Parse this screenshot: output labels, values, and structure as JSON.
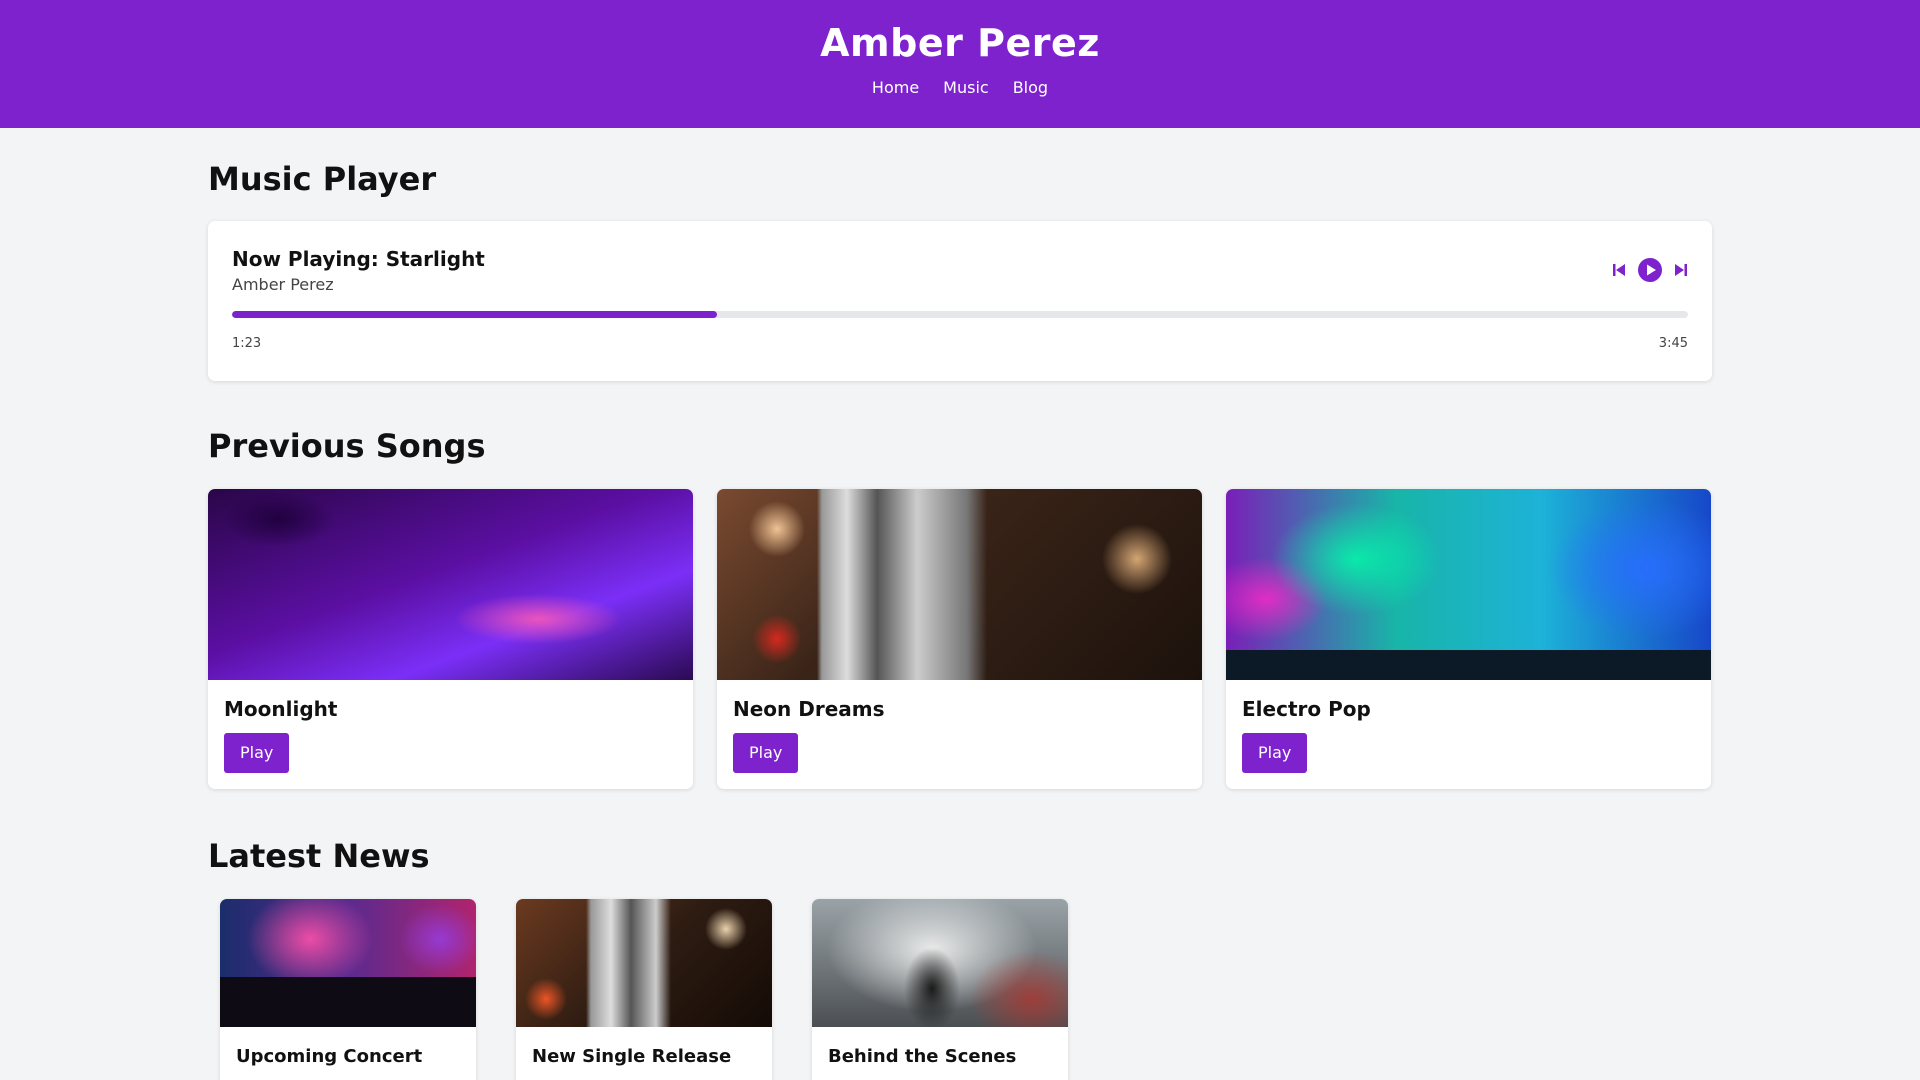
{
  "header": {
    "title": "Amber Perez",
    "nav": [
      "Home",
      "Music",
      "Blog"
    ]
  },
  "player": {
    "heading": "Music Player",
    "now_playing": "Now Playing: Starlight",
    "artist": "Amber Perez",
    "current_time": "1:23",
    "total_time": "3:45",
    "progress_fraction": 0.333,
    "controls": [
      "skip-previous-icon",
      "play-icon",
      "skip-next-icon"
    ],
    "accent_color": "#7e22ce"
  },
  "previous_songs": {
    "heading": "Previous Songs",
    "items": [
      {
        "title": "Moonlight",
        "button": "Play",
        "image": "dj-turntable-image"
      },
      {
        "title": "Neon Dreams",
        "button": "Play",
        "image": "microphone-image"
      },
      {
        "title": "Electro Pop",
        "button": "Play",
        "image": "concert-lights-image"
      }
    ]
  },
  "news": {
    "heading": "Latest News",
    "items": [
      {
        "title": "Upcoming Concert",
        "image": "concert-crowd-image"
      },
      {
        "title": "New Single Release",
        "image": "microphone-image"
      },
      {
        "title": "Behind the Scenes",
        "image": "performer-smoke-image"
      }
    ]
  }
}
